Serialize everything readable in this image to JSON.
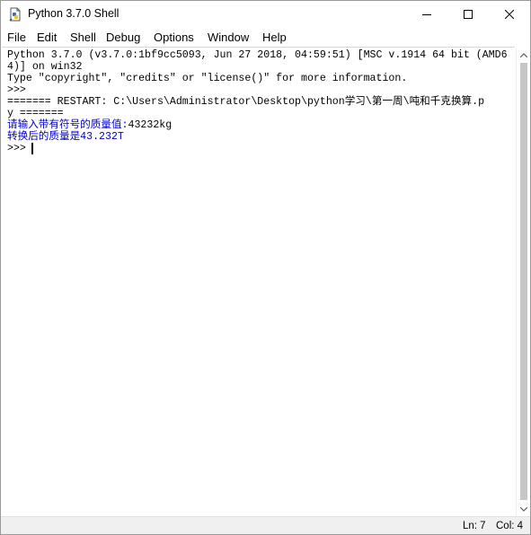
{
  "window": {
    "title": "Python 3.7.0 Shell",
    "icon": "python-idle-icon"
  },
  "menu": {
    "items": [
      "File",
      "Edit",
      "Shell",
      "Debug",
      "Options",
      "Window",
      "Help"
    ]
  },
  "shell": {
    "lines": [
      "Python 3.7.0 (v3.7.0:1bf9cc5093, Jun 27 2018, 04:59:51) [MSC v.1914 64 bit (AMD6",
      "4)] on win32",
      "Type \"copyright\", \"credits\" or \"license()\" for more information.",
      ">>> ",
      "======= RESTART: C:\\Users\\Administrator\\Desktop\\python学习\\第一周\\吨和千克换算.p",
      "y ======="
    ],
    "input_prompt": "请输入带有符号的质量值:",
    "input_value": "43232kg",
    "output_line": "转换后的质量是43.232T",
    "prompt": ">>> "
  },
  "status": {
    "line": "Ln: 7",
    "col": "Col: 4"
  },
  "colors": {
    "output_blue": "#0000c8",
    "text": "#000000"
  }
}
